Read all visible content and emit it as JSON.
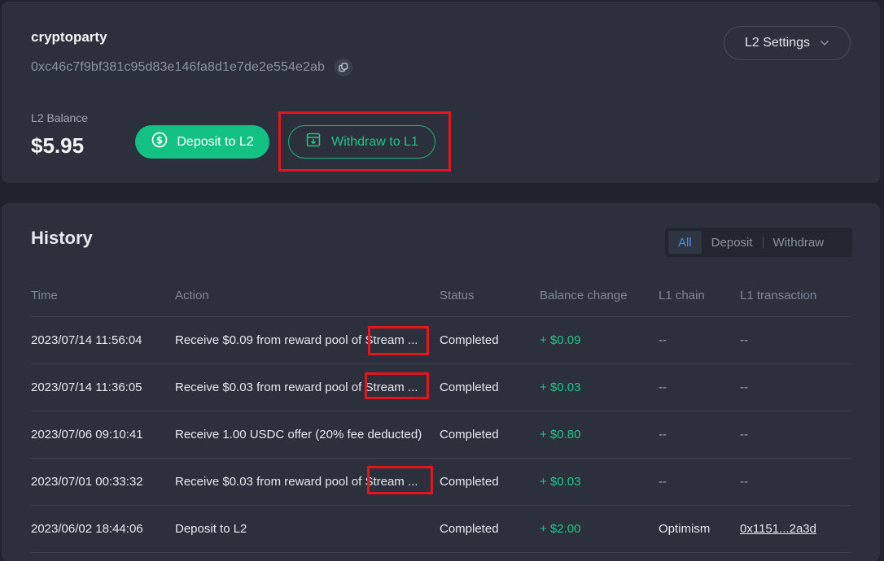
{
  "account": {
    "name": "cryptoparty",
    "address": "0xc46c7f9bf381c95d83e146fa8d1e7de2e554e2ab",
    "copy_icon": "copy-icon"
  },
  "settings": {
    "label": "L2 Settings",
    "icon": "chevron-down-icon"
  },
  "balance": {
    "label": "L2 Balance",
    "value": "$5.95",
    "deposit_label": "Deposit to L2",
    "withdraw_label": "Withdraw to L1"
  },
  "colors": {
    "accent_green": "#14c184",
    "highlight_red": "#e8141c",
    "filter_active": "#4c8df6"
  },
  "history": {
    "title": "History",
    "filters": [
      "All",
      "Deposit",
      "Withdraw"
    ],
    "active_filter": "All",
    "columns": [
      "Time",
      "Action",
      "Status",
      "Balance change",
      "L1 chain",
      "L1 transaction"
    ],
    "rows": [
      {
        "time": "2023/07/14 11:56:04",
        "action": "Receive $0.09 from reward pool of Stream ...",
        "status": "Completed",
        "change": "+ $0.09",
        "chain": "--",
        "tx": "--"
      },
      {
        "time": "2023/07/14 11:36:05",
        "action": "Receive $0.03 from reward pool of Stream ...",
        "status": "Completed",
        "change": "+ $0.03",
        "chain": "--",
        "tx": "--"
      },
      {
        "time": "2023/07/06 09:10:41",
        "action": "Receive 1.00 USDC offer (20% fee deducted)",
        "status": "Completed",
        "change": "+ $0.80",
        "chain": "--",
        "tx": "--"
      },
      {
        "time": "2023/07/01 00:33:32",
        "action": "Receive $0.03 from reward pool of Stream ...",
        "status": "Completed",
        "change": "+ $0.03",
        "chain": "--",
        "tx": "--"
      },
      {
        "time": "2023/06/02 18:44:06",
        "action": "Deposit to L2",
        "status": "Completed",
        "change": "+ $2.00",
        "chain": "Optimism",
        "tx": "0x1151...2a3d"
      }
    ]
  }
}
